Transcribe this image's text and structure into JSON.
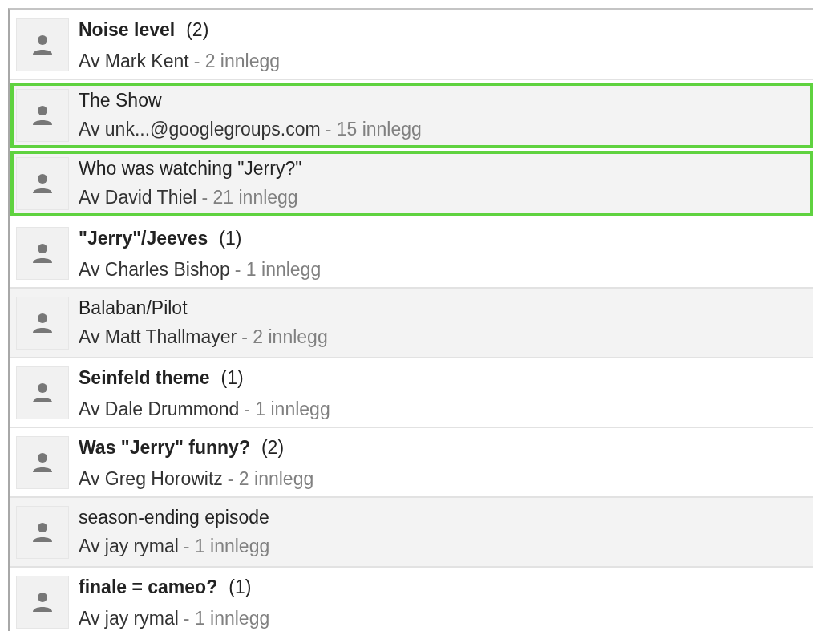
{
  "threads": [
    {
      "title": "Noise level",
      "count": "(2)",
      "unread": true,
      "highlighted": false,
      "author": "Av Mark Kent",
      "posts": "- 2 innlegg"
    },
    {
      "title": "The Show",
      "unread": false,
      "highlighted": true,
      "author": "Av unk...@googlegroups.com",
      "posts": "- 15 innlegg"
    },
    {
      "title": "Who was watching \"Jerry?\"",
      "unread": false,
      "highlighted": true,
      "author": "Av David Thiel",
      "posts": "- 21 innlegg"
    },
    {
      "title": "\"Jerry\"/Jeeves",
      "count": "(1)",
      "unread": true,
      "highlighted": false,
      "author": "Av Charles Bishop",
      "posts": "- 1 innlegg"
    },
    {
      "title": "Balaban/Pilot",
      "unread": false,
      "highlighted": false,
      "author": "Av Matt Thallmayer",
      "posts": "- 2 innlegg"
    },
    {
      "title": "Seinfeld theme",
      "count": "(1)",
      "unread": true,
      "highlighted": false,
      "author": "Av Dale Drummond",
      "posts": "- 1 innlegg"
    },
    {
      "title": "Was \"Jerry\" funny?",
      "count": "(2)",
      "unread": true,
      "highlighted": false,
      "author": "Av Greg Horowitz",
      "posts": "- 2 innlegg"
    },
    {
      "title": "season-ending episode",
      "unread": false,
      "highlighted": false,
      "author": "Av jay rymal",
      "posts": "- 1 innlegg"
    },
    {
      "title": "finale = cameo?",
      "count": "(1)",
      "unread": true,
      "highlighted": false,
      "author": "Av jay rymal",
      "posts": "- 1 innlegg"
    }
  ]
}
